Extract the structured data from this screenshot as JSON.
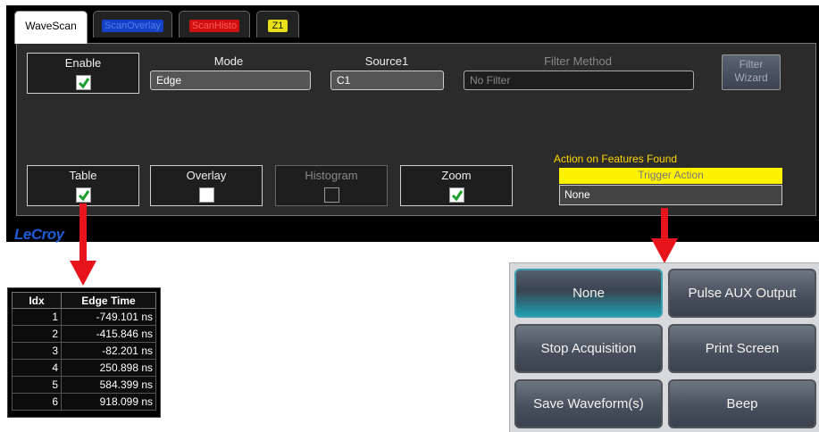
{
  "tabs": [
    {
      "label": "WaveScan",
      "bg": "#ffffff",
      "fg": "#000000"
    },
    {
      "label": "ScanOverlay",
      "bg": "#1540c8",
      "fg": "#4d7fe8"
    },
    {
      "label": "ScanHisto",
      "bg": "#d01010",
      "fg": "#ff5a5a"
    },
    {
      "label": "Z1",
      "bg": "#e6df1a",
      "fg": "#1a1a1a"
    }
  ],
  "enable": {
    "label": "Enable",
    "checked": true
  },
  "mode": {
    "label": "Mode",
    "value": "Edge"
  },
  "source": {
    "label": "Source1",
    "value": "C1"
  },
  "filter": {
    "label": "Filter Method",
    "value": "No Filter"
  },
  "filter_wizard": {
    "line1": "Filter",
    "line2": "Wizard"
  },
  "toggles": {
    "table": {
      "label": "Table",
      "checked": true
    },
    "overlay": {
      "label": "Overlay",
      "checked": false
    },
    "histogram": {
      "label": "Histogram",
      "checked": false
    },
    "zoom": {
      "label": "Zoom",
      "checked": true
    }
  },
  "action": {
    "title": "Action on Features Found",
    "trigger_label": "Trigger Action",
    "trigger_value": "None"
  },
  "logo": "LeCroy",
  "colors": {
    "accent_yellow": "#fff200",
    "arrow_red": "#e8141b",
    "check_green": "#1e9e2e",
    "logo_blue": "#1d5bd6"
  },
  "result_table": {
    "headers": [
      "Idx",
      "Edge Time"
    ],
    "rows": [
      {
        "idx": "1",
        "time": "-749.101 ns"
      },
      {
        "idx": "2",
        "time": "-415.846 ns"
      },
      {
        "idx": "3",
        "time": "-82.201 ns"
      },
      {
        "idx": "4",
        "time": "250.898 ns"
      },
      {
        "idx": "5",
        "time": "584.399 ns"
      },
      {
        "idx": "6",
        "time": "918.099 ns"
      }
    ]
  },
  "action_buttons": [
    {
      "label": "None",
      "selected": true
    },
    {
      "label": "Pulse AUX Output",
      "selected": false
    },
    {
      "label": "Stop Acquisition",
      "selected": false
    },
    {
      "label": "Print Screen",
      "selected": false
    },
    {
      "label": "Save Waveform(s)",
      "selected": false
    },
    {
      "label": "Beep",
      "selected": false
    }
  ]
}
